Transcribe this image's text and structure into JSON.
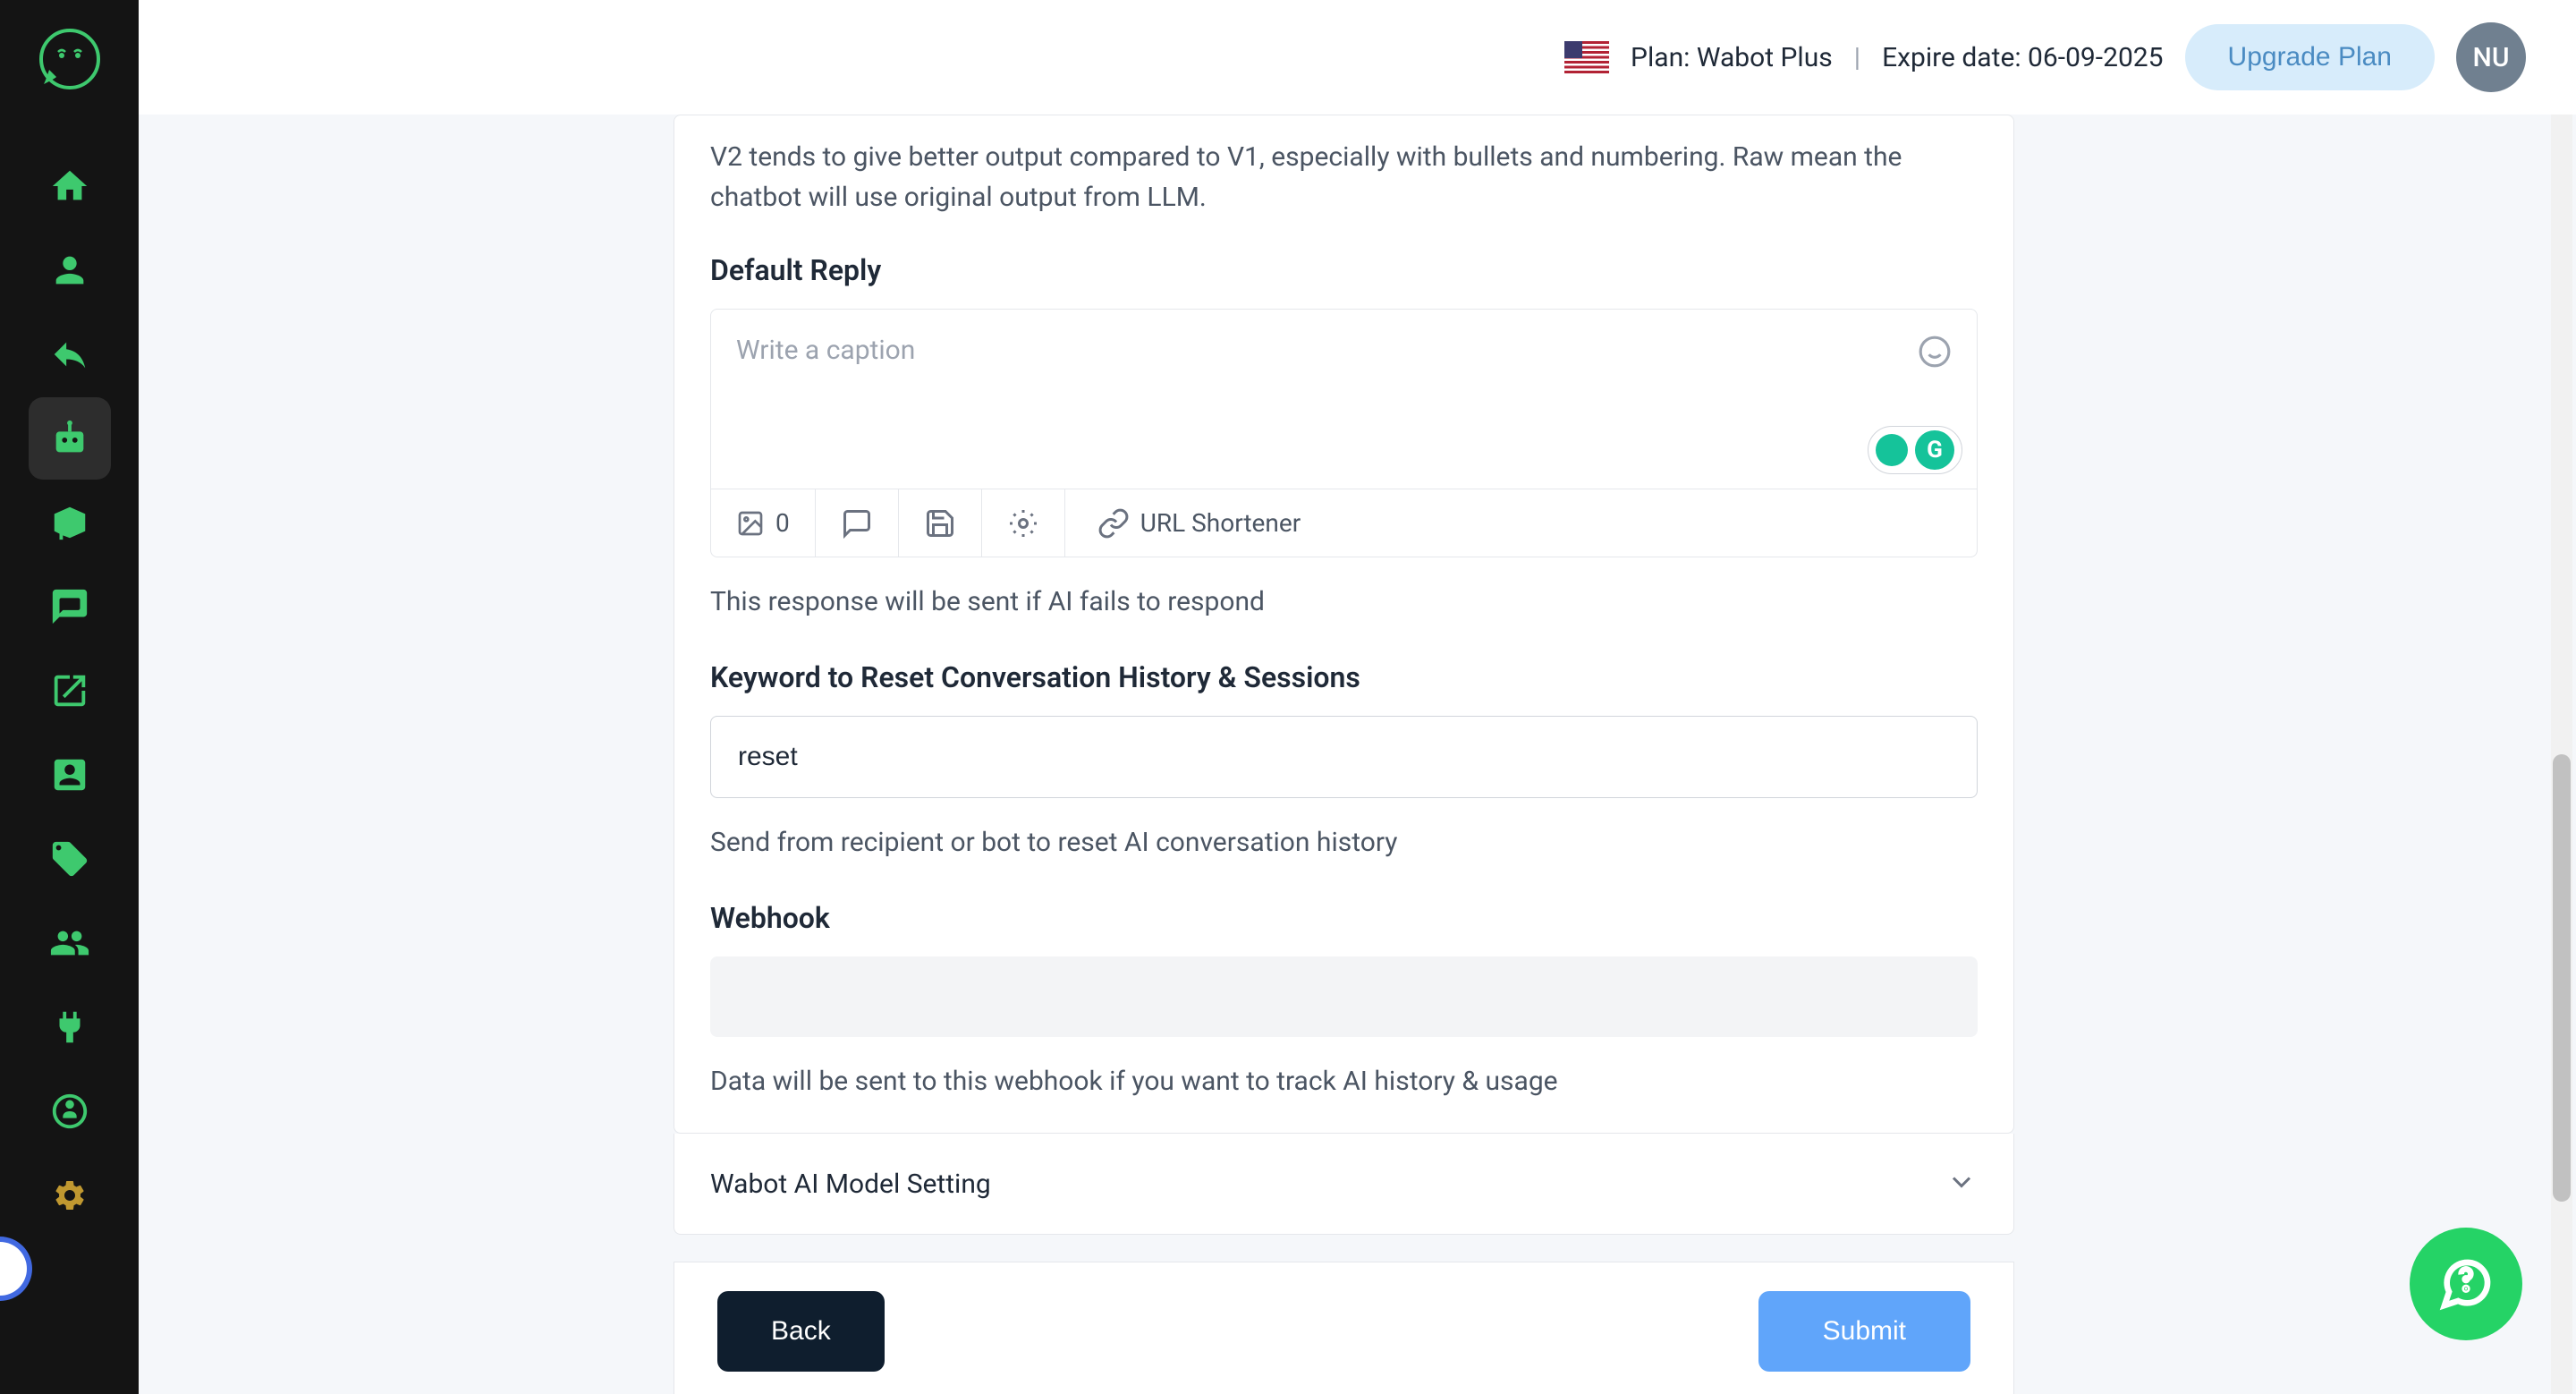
{
  "header": {
    "plan_label": "Plan: Wabot Plus",
    "expire_label": "Expire date: 06-09-2025",
    "divider": "|",
    "upgrade_label": "Upgrade Plan",
    "avatar_initials": "NU"
  },
  "content": {
    "v2_hint": "V2 tends to give better output compared to V1, especially with bullets and numbering. Raw mean the chatbot will use original output from LLM.",
    "default_reply_label": "Default Reply",
    "default_reply_placeholder": "Write a caption",
    "default_reply_help": "This response will be sent if AI fails to respond",
    "keyword_reset_label": "Keyword to Reset Conversation History & Sessions",
    "keyword_reset_value": "reset",
    "keyword_reset_help": "Send from recipient or bot to reset AI conversation history",
    "webhook_label": "Webhook",
    "webhook_value": "",
    "webhook_help": "Data will be sent to this webhook if you want to track AI history & usage",
    "accordion_title": "Wabot AI Model Setting"
  },
  "toolbar": {
    "count": "0",
    "url_shortener": "URL Shortener"
  },
  "footer": {
    "back": "Back",
    "submit": "Submit"
  }
}
